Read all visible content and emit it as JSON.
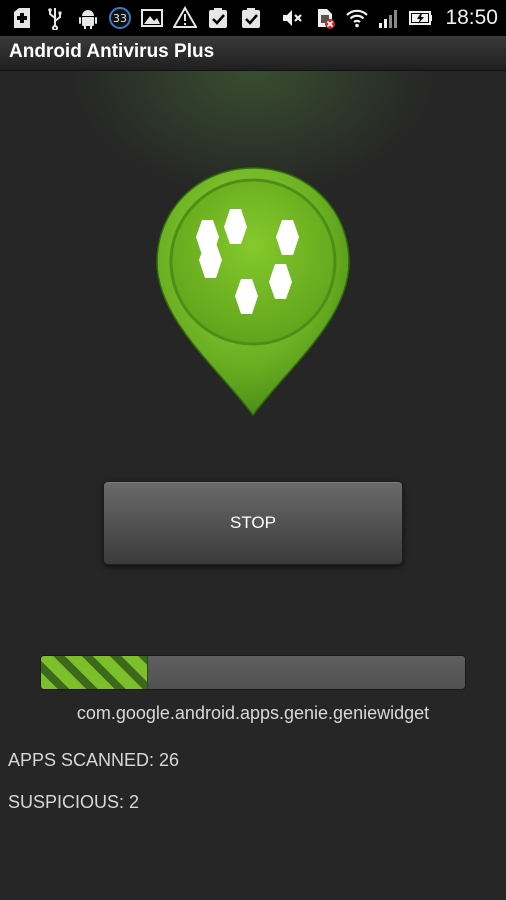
{
  "status_bar": {
    "icons_left": [
      "add-box-icon",
      "usb-icon",
      "android-icon",
      "badge-33-icon",
      "image-icon",
      "warning-icon",
      "check-clipboard-icon",
      "check-clipboard-icon"
    ],
    "badge_count": "33",
    "icons_right": [
      "mute-icon",
      "no-sim-icon",
      "wifi-icon",
      "signal-icon",
      "battery-charging-icon"
    ],
    "time": "18:50"
  },
  "app": {
    "title": "Android Antivirus Plus"
  },
  "scan": {
    "stop_label": "STOP",
    "progress_fraction": 0.25,
    "current_item": "com.google.android.apps.genie.geniewidget",
    "apps_scanned": "APPS SCANNED: 26",
    "suspicious": "SUSPICIOUS: 2"
  },
  "colors": {
    "accent_green": "#7cbf2a",
    "background": "#262626",
    "button": "#4e4e4e"
  }
}
